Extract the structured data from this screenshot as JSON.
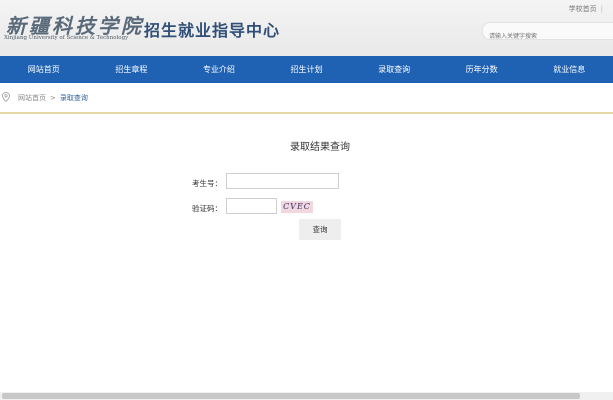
{
  "header": {
    "logo_cn": "新疆科技学院",
    "logo_en": "Xinjiang University of Science & Technology",
    "center_title": "招生就业指导中心",
    "top_link": "学校首页",
    "search_placeholder": "请输入关键字搜索"
  },
  "nav": {
    "items": [
      "网站首页",
      "招生章程",
      "专业介绍",
      "招生计划",
      "录取查询",
      "历年分数",
      "就业信息"
    ]
  },
  "breadcrumb": {
    "home": "网站首页",
    "separator": ">",
    "current": "录取查询"
  },
  "form": {
    "title": "录取结果查询",
    "exam_no_label": "考生号：",
    "exam_no_value": "",
    "captcha_label": "验证码：",
    "captcha_value": "",
    "captcha_text": "CVEC",
    "submit_label": "查询"
  },
  "colors": {
    "nav_bg": "#1f62b4",
    "title_color": "#2f4f78",
    "breadcrumb_line": "#e6d8a2"
  }
}
